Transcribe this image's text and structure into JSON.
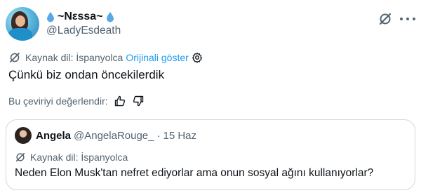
{
  "author": {
    "display_name": "~Nεssa~",
    "handle": "@LadyEsdeath"
  },
  "translation": {
    "source_label": "Kaynak dil: İspanyolca",
    "show_original": "Orijinali göster"
  },
  "tweet": {
    "text": "Çünkü biz ondan öncekilerdik"
  },
  "rating": {
    "label": "Bu çeviriyi değerlendir:"
  },
  "quote": {
    "display_name": "Angela",
    "handle": "@AngelaRouge_",
    "dot": "·",
    "date": "15 Haz",
    "source_label": "Kaynak dil: İspanyolca",
    "text": "Neden Elon Musk'tan nefret ediyorlar ama onun sosyal ağını kullanıyorlar?"
  },
  "colors": {
    "accent": "#1d9bf0",
    "text": "#0f1419",
    "muted": "#536471",
    "border": "#cfd9de",
    "drop": "#5aa9e6"
  },
  "icons": {
    "verified_drops": "water-drop-icon",
    "grok": "grok-icon",
    "more": "more-icon",
    "translate": "translate-icon",
    "gear": "gear-icon",
    "thumbs_up": "thumbs-up-icon",
    "thumbs_down": "thumbs-down-icon"
  }
}
